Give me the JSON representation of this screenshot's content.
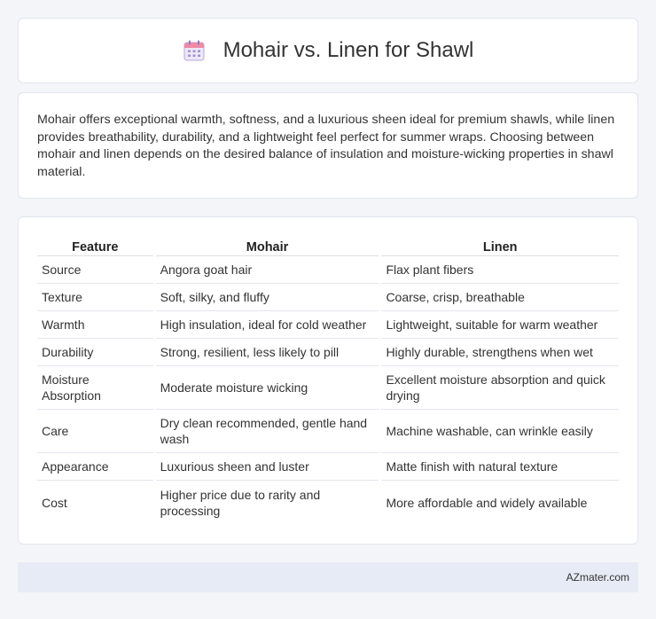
{
  "header": {
    "title": "Mohair vs. Linen for Shawl",
    "icon": "calendar-icon"
  },
  "description": "Mohair offers exceptional warmth, softness, and a luxurious sheen ideal for premium shawls, while linen provides breathability, durability, and a lightweight feel perfect for summer wraps. Choosing between mohair and linen depends on the desired balance of insulation and moisture-wicking properties in shawl material.",
  "table": {
    "columns": [
      "Feature",
      "Mohair",
      "Linen"
    ],
    "rows": [
      [
        "Source",
        "Angora goat hair",
        "Flax plant fibers"
      ],
      [
        "Texture",
        "Soft, silky, and fluffy",
        "Coarse, crisp, breathable"
      ],
      [
        "Warmth",
        "High insulation, ideal for cold weather",
        "Lightweight, suitable for warm weather"
      ],
      [
        "Durability",
        "Strong, resilient, less likely to pill",
        "Highly durable, strengthens when wet"
      ],
      [
        "Moisture Absorption",
        "Moderate moisture wicking",
        "Excellent moisture absorption and quick drying"
      ],
      [
        "Care",
        "Dry clean recommended, gentle hand wash",
        "Machine washable, can wrinkle easily"
      ],
      [
        "Appearance",
        "Luxurious sheen and luster",
        "Matte finish with natural texture"
      ],
      [
        "Cost",
        "Higher price due to rarity and processing",
        "More affordable and widely available"
      ]
    ]
  },
  "footer": {
    "text": "AZmater.com"
  },
  "colors": {
    "background": "#f3f5f9",
    "card": "#ffffff",
    "footer": "#e6ebf5",
    "icon_accent": "#8e7cc3"
  }
}
